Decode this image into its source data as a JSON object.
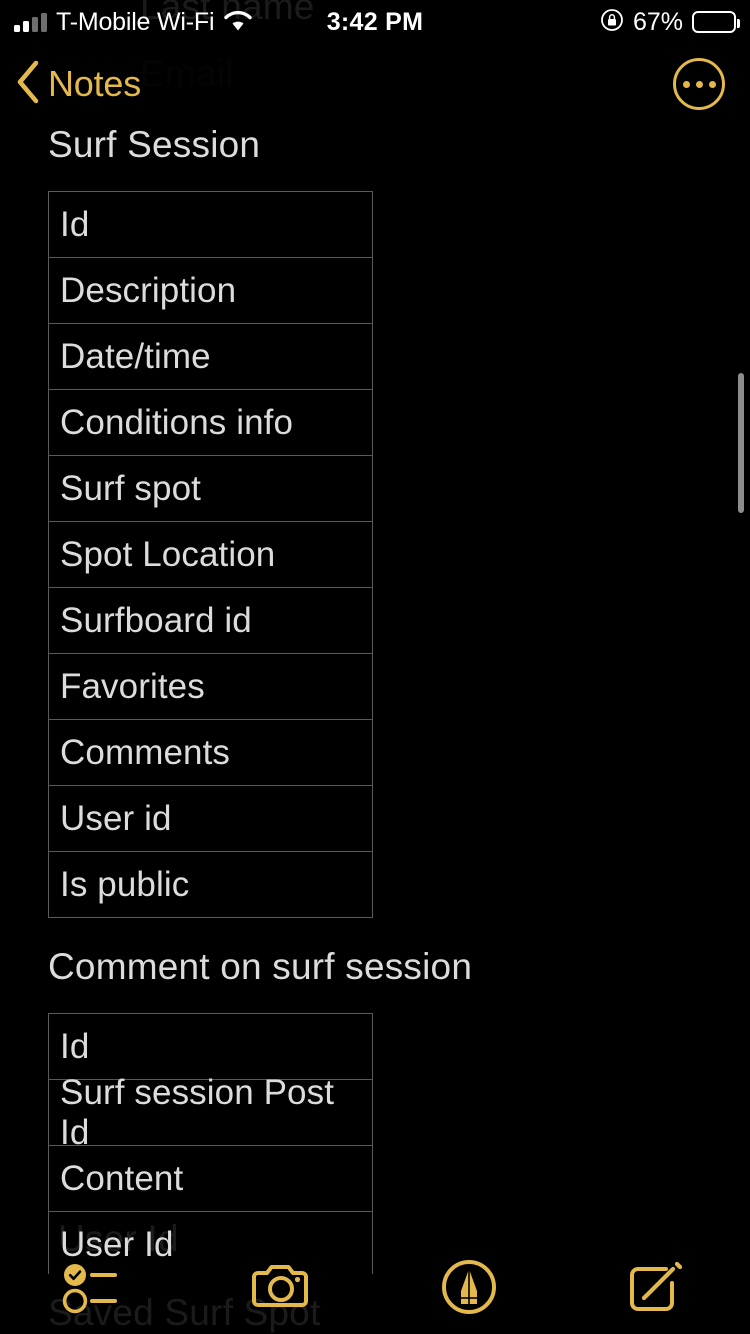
{
  "status_bar": {
    "signal_icon": "cellular-bars-icon",
    "carrier": "T-Mobile Wi-Fi",
    "wifi_icon": "wifi-icon",
    "time": "3:42 PM",
    "rotation_lock_icon": "rotation-lock-icon",
    "battery_percent": "67%",
    "battery_level": 67,
    "battery_icon": "battery-icon"
  },
  "nav_bar": {
    "back_icon": "chevron-left-icon",
    "back_label": "Notes",
    "more_icon": "more-circle-icon"
  },
  "note": {
    "ghost_text": {
      "top_partial": "Last name",
      "second_partial": "Email",
      "bottom_partial": "User Id",
      "bottom_heading": "Saved Surf Spot"
    },
    "sections": [
      {
        "title": "Surf Session",
        "rows": [
          "Id",
          "Description",
          "Date/time",
          "Conditions info",
          "Surf spot",
          "Spot Location",
          "Surfboard id",
          "Favorites",
          "Comments",
          "User id",
          "Is public"
        ]
      },
      {
        "title": "Comment on surf session",
        "rows": [
          "Id",
          "Surf session Post Id",
          "Content",
          "User Id"
        ]
      }
    ]
  },
  "toolbar": {
    "items": [
      {
        "name": "checklist-icon",
        "label": "Checklist"
      },
      {
        "name": "camera-icon",
        "label": "Camera"
      },
      {
        "name": "markup-pen-icon",
        "label": "Markup"
      },
      {
        "name": "compose-icon",
        "label": "New Note"
      }
    ]
  },
  "colors": {
    "accent_gold": "#E3B94C",
    "background": "#000000",
    "text_primary": "#DCDCDC",
    "table_border": "#5A5A5A",
    "scrollbar": "#8C8C8C"
  }
}
